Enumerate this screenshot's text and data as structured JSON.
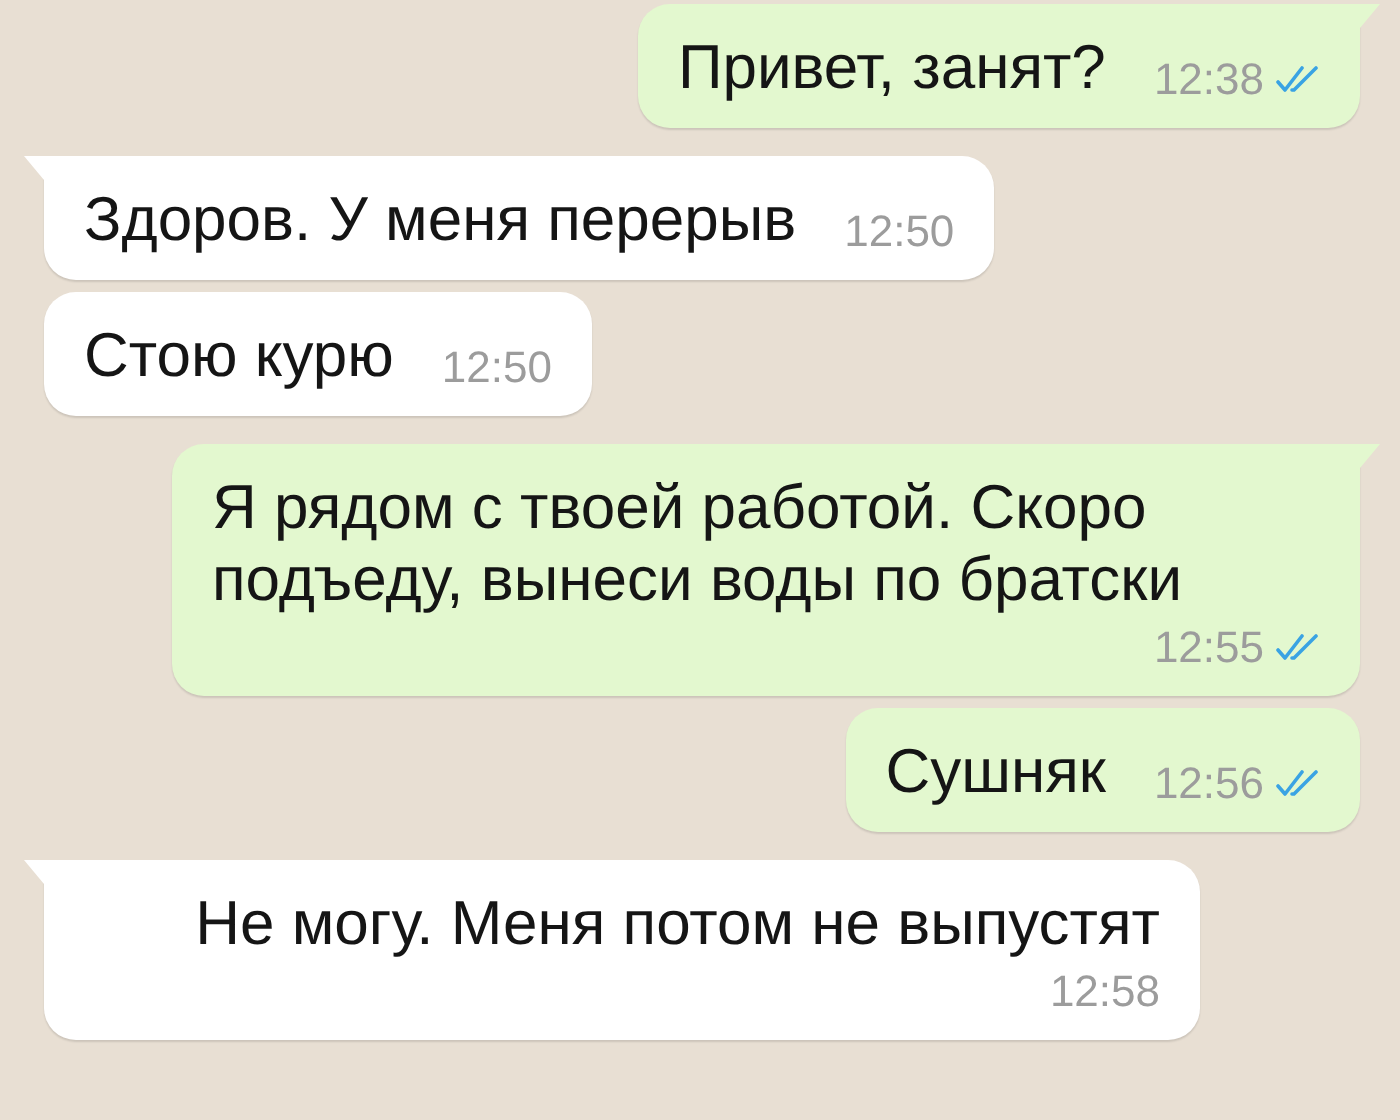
{
  "messages": [
    {
      "outgoing": true,
      "tail": true,
      "text": "Привет, занят?",
      "time": "12:38",
      "read": true
    },
    {
      "outgoing": false,
      "tail": true,
      "text": "Здоров. У меня перерыв",
      "time": "12:50"
    },
    {
      "outgoing": false,
      "tail": false,
      "text": "Стою курю",
      "time": "12:50"
    },
    {
      "outgoing": true,
      "tail": true,
      "text": "Я рядом с твоей работой. Скоро подъеду, вынеси воды по братски",
      "time": "12:55",
      "read": true
    },
    {
      "outgoing": true,
      "tail": false,
      "text": "Сушняк",
      "time": "12:56",
      "read": true
    },
    {
      "outgoing": false,
      "tail": true,
      "text": "Не могу. Меня потом не выпустят",
      "time": "12:58"
    }
  ]
}
